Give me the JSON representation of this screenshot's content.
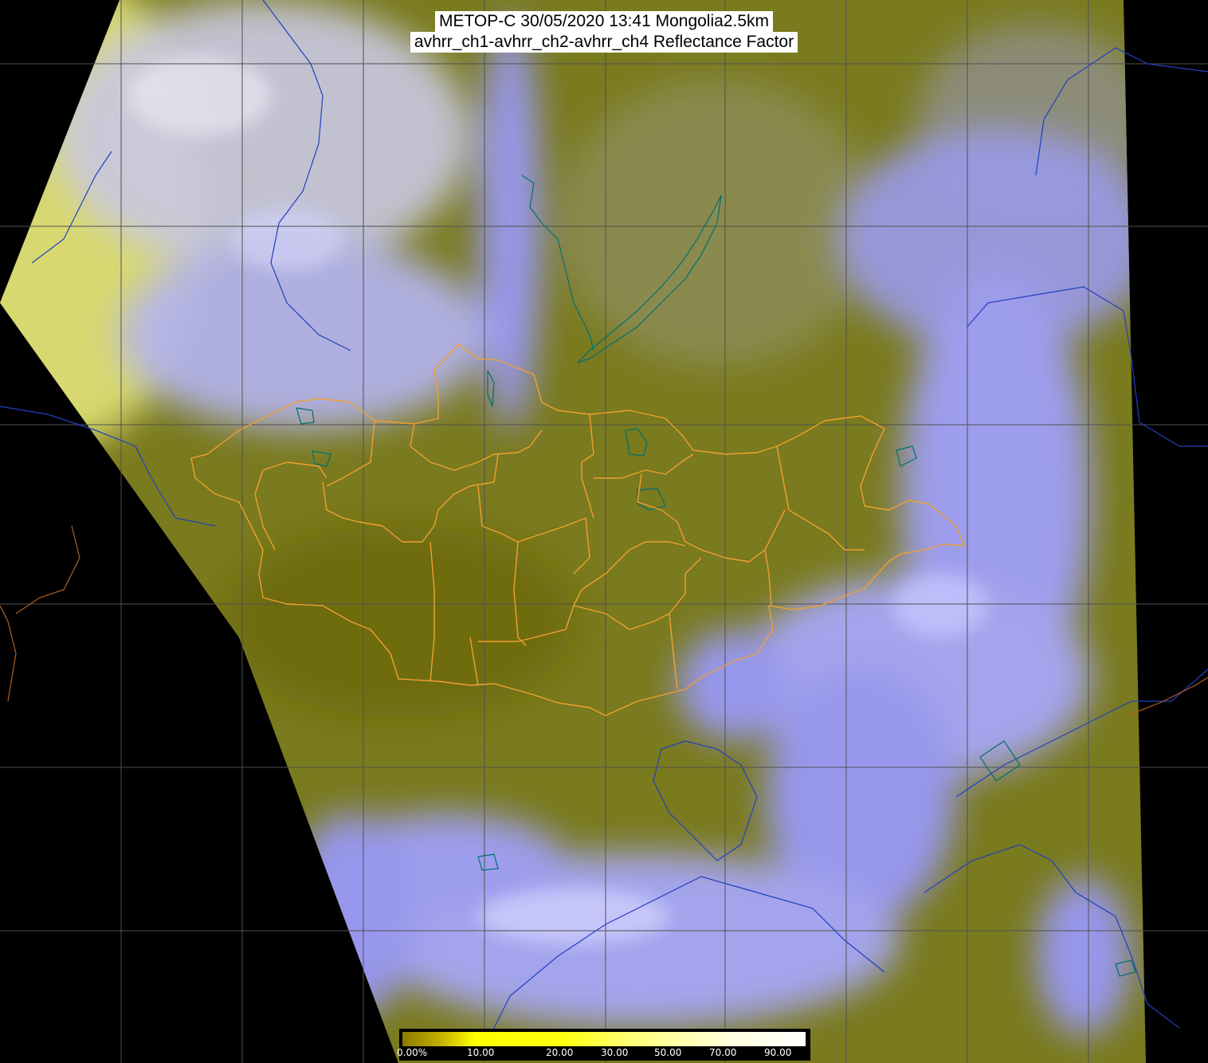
{
  "title": {
    "line1": "METOP-C 30/05/2020 13:41 Mongolia2.5km",
    "line2": "avhrr_ch1-avhrr_ch2-avhrr_ch4 Reflectance Factor"
  },
  "colorbar": {
    "labels": [
      "0.00%",
      "10.00",
      "20.00",
      "30.00",
      "50.00",
      "70.00",
      "90.00"
    ]
  },
  "colors": {
    "background": "#000000",
    "land": "#7a7a1e",
    "cloud": "#9a9aff",
    "country_border": "#f0a030",
    "coastline_river": "#2040c0",
    "lake": "#007070",
    "graticule": "#505050"
  }
}
